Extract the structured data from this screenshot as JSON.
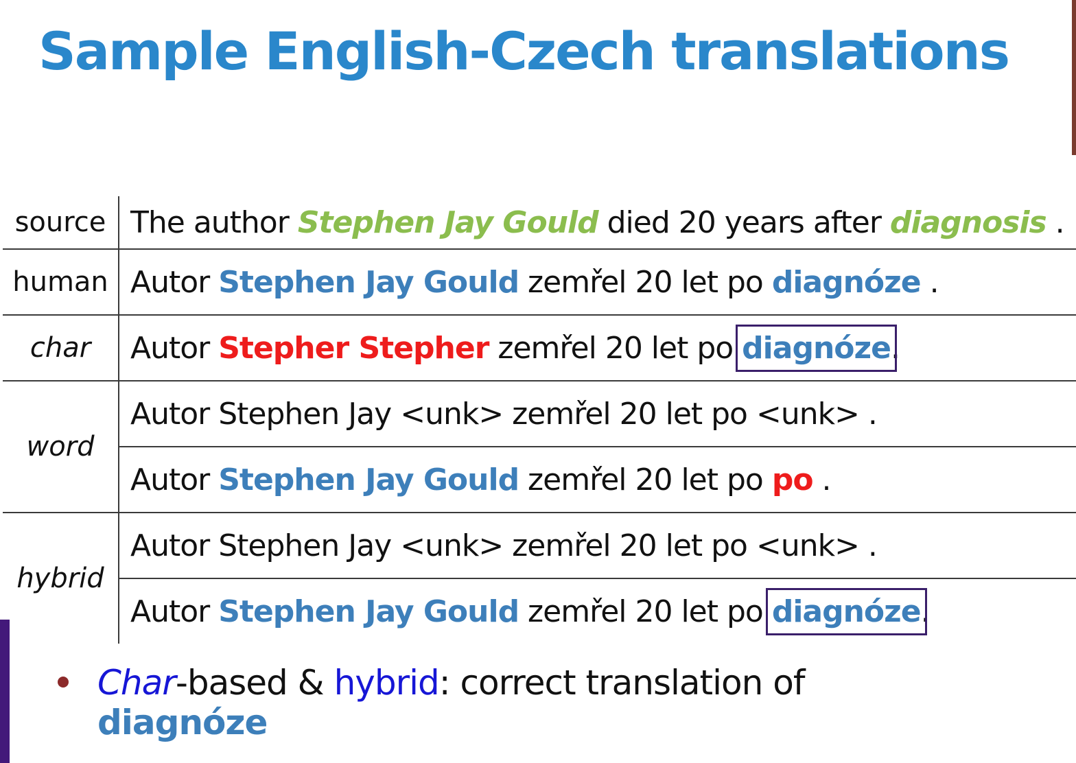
{
  "title": "Sample English-Czech translations",
  "labels": {
    "source": "source",
    "human": "human",
    "char": "char",
    "word": "word",
    "hybrid": "hybrid"
  },
  "rows": {
    "source": [
      {
        "t": "The author ",
        "s": "plain"
      },
      {
        "t": "Stephen Jay Gould",
        "s": "green"
      },
      {
        "t": " died 20 years after ",
        "s": "plain"
      },
      {
        "t": "diagnosis",
        "s": "green"
      },
      {
        "t": " .",
        "s": "plain"
      }
    ],
    "human": [
      {
        "t": "Autor ",
        "s": "plain"
      },
      {
        "t": "Stephen Jay Gould",
        "s": "blue"
      },
      {
        "t": " zemřel 20 let po ",
        "s": "plain"
      },
      {
        "t": "diagnóze",
        "s": "blue"
      },
      {
        "t": " .",
        "s": "plain"
      }
    ],
    "char": [
      {
        "t": "Autor ",
        "s": "plain"
      },
      {
        "t": "Stepher Stepher",
        "s": "red"
      },
      {
        "t": " zemřel 20 let po ",
        "s": "plain"
      },
      {
        "t": "diagnóze",
        "s": "blue-boxed"
      },
      {
        "t": ".",
        "s": "plain"
      }
    ],
    "word1": [
      {
        "t": "Autor Stephen Jay <unk> zemřel 20 let po <unk> .",
        "s": "plain"
      }
    ],
    "word2": [
      {
        "t": "Autor ",
        "s": "plain"
      },
      {
        "t": "Stephen Jay Gould",
        "s": "blue"
      },
      {
        "t": " zemřel 20 let po ",
        "s": "plain"
      },
      {
        "t": "po",
        "s": "red"
      },
      {
        "t": " .",
        "s": "plain"
      }
    ],
    "hybrid1": [
      {
        "t": "Autor Stephen Jay <unk> zemřel 20 let po <unk> .",
        "s": "plain"
      }
    ],
    "hybrid2": [
      {
        "t": "Autor ",
        "s": "plain"
      },
      {
        "t": "Stephen Jay Gould",
        "s": "blue"
      },
      {
        "t": " zemřel 20 let po ",
        "s": "plain"
      },
      {
        "t": "diagnóze",
        "s": "blue-boxed"
      },
      {
        "t": ".",
        "s": "plain"
      }
    ]
  },
  "bullet": {
    "char_word": "Char",
    "based": "-based & ",
    "hybrid_word": "hybrid",
    "rest": ": correct translation of",
    "term": "diagnóze"
  },
  "colors": {
    "title": "#2a87cb",
    "source_highlight": "#8bbd4e",
    "correct": "#3d7fba",
    "error": "#ee1c1c",
    "box": "#3a1f6a",
    "emphasis": "#1616d6"
  }
}
